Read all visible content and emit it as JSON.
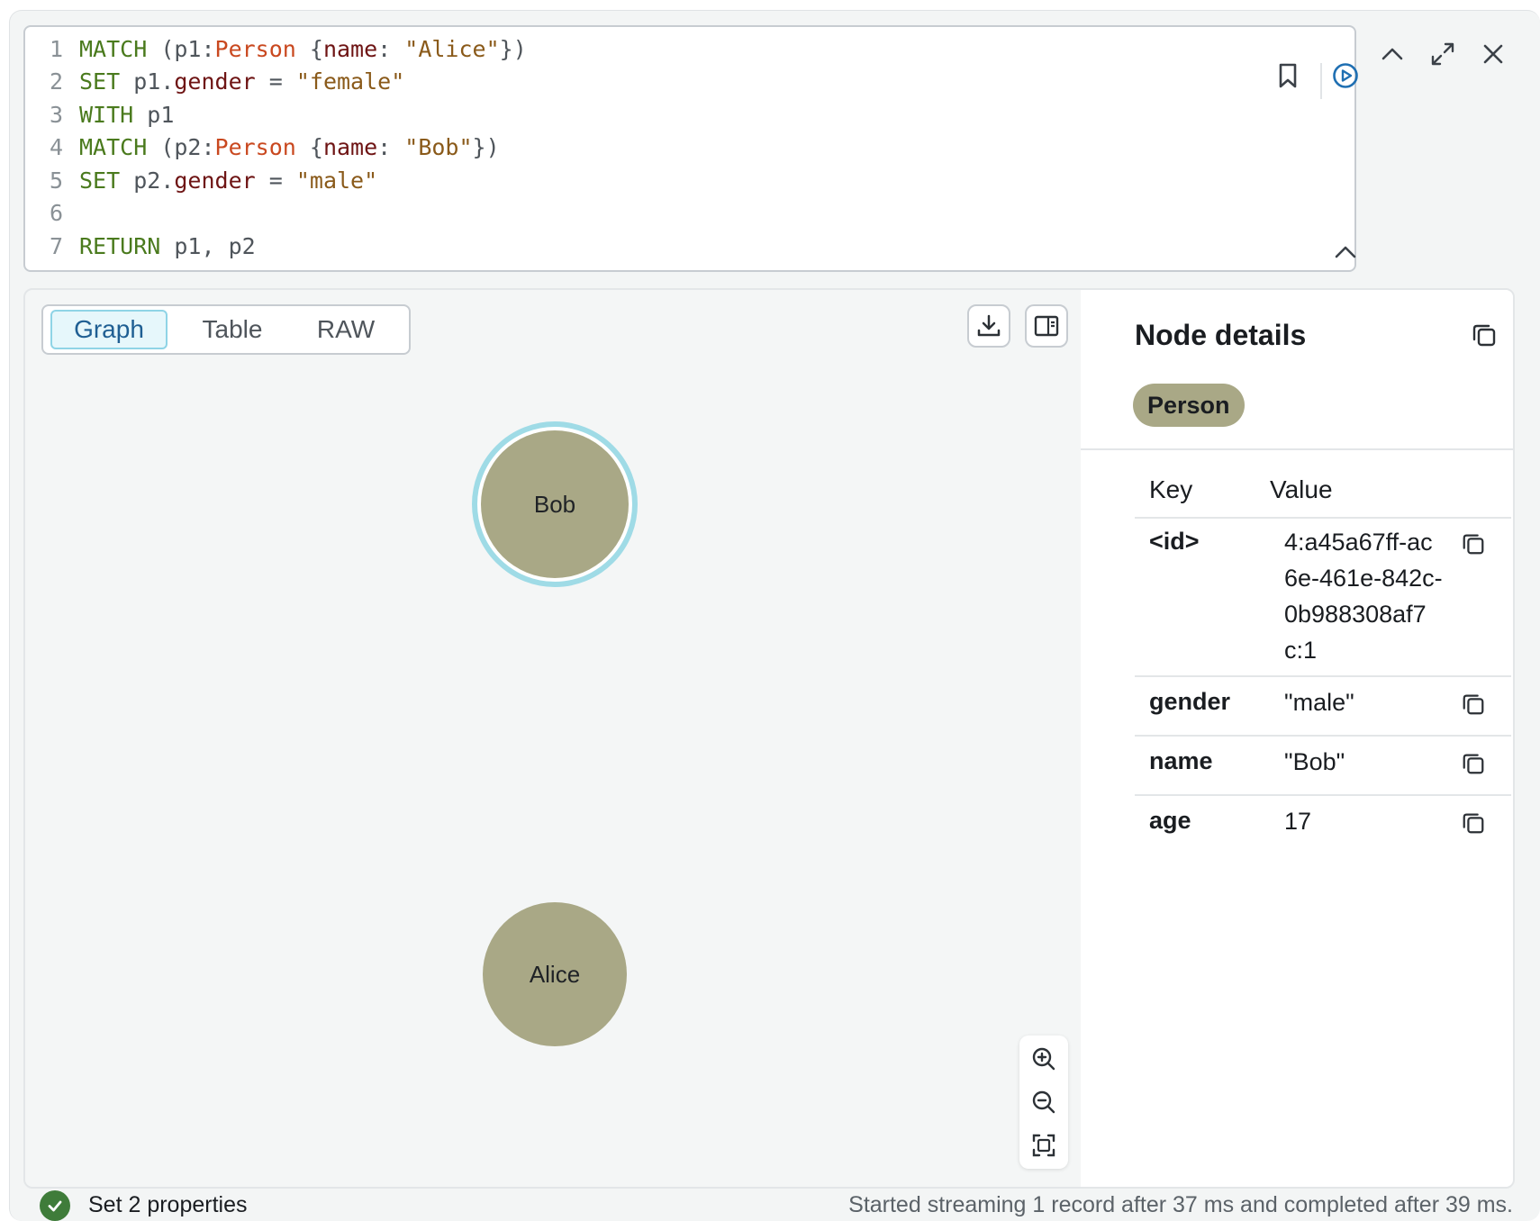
{
  "editor": {
    "lines": [
      {
        "num": "1",
        "tokens": [
          {
            "t": "MATCH",
            "c": "kw"
          },
          {
            "t": " (p1:",
            "c": "plain"
          },
          {
            "t": "Person",
            "c": "lbl"
          },
          {
            "t": " {",
            "c": "plain"
          },
          {
            "t": "name",
            "c": "prop"
          },
          {
            "t": ": ",
            "c": "plain"
          },
          {
            "t": "\"Alice\"",
            "c": "str"
          },
          {
            "t": "})",
            "c": "plain"
          }
        ]
      },
      {
        "num": "2",
        "tokens": [
          {
            "t": "SET",
            "c": "kw"
          },
          {
            "t": " p1.",
            "c": "plain"
          },
          {
            "t": "gender",
            "c": "prop"
          },
          {
            "t": " = ",
            "c": "plain"
          },
          {
            "t": "\"female\"",
            "c": "str"
          }
        ]
      },
      {
        "num": "3",
        "tokens": [
          {
            "t": "WITH",
            "c": "kw"
          },
          {
            "t": " p1",
            "c": "plain"
          }
        ]
      },
      {
        "num": "4",
        "tokens": [
          {
            "t": "MATCH",
            "c": "kw"
          },
          {
            "t": " (p2:",
            "c": "plain"
          },
          {
            "t": "Person",
            "c": "lbl"
          },
          {
            "t": " {",
            "c": "plain"
          },
          {
            "t": "name",
            "c": "prop"
          },
          {
            "t": ": ",
            "c": "plain"
          },
          {
            "t": "\"Bob\"",
            "c": "str"
          },
          {
            "t": "})",
            "c": "plain"
          }
        ]
      },
      {
        "num": "5",
        "tokens": [
          {
            "t": "SET",
            "c": "kw"
          },
          {
            "t": " p2.",
            "c": "plain"
          },
          {
            "t": "gender",
            "c": "prop"
          },
          {
            "t": " = ",
            "c": "plain"
          },
          {
            "t": "\"male\"",
            "c": "str"
          }
        ]
      },
      {
        "num": "6",
        "tokens": []
      },
      {
        "num": "7",
        "tokens": [
          {
            "t": "RETURN",
            "c": "kw"
          },
          {
            "t": " p1, p2",
            "c": "plain"
          }
        ]
      }
    ]
  },
  "icons": {
    "bookmark": "bookmark-icon",
    "run": "play-circle-icon",
    "collapse": "chevron-up-icon",
    "expand": "expand-icon",
    "close": "close-icon",
    "download": "download-icon",
    "panel": "side-panel-icon",
    "zoom_in": "zoom-in-icon",
    "zoom_out": "zoom-out-icon",
    "fit": "fit-to-screen-icon",
    "copy": "copy-icon",
    "check": "check-icon"
  },
  "tabs": [
    {
      "label": "Graph",
      "active": true
    },
    {
      "label": "Table",
      "active": false
    },
    {
      "label": "RAW",
      "active": false
    }
  ],
  "graph": {
    "nodes": [
      {
        "label": "Bob",
        "selected": true
      },
      {
        "label": "Alice",
        "selected": false
      }
    ],
    "node_color": "#a9a886",
    "selection_color": "#9fdbe6"
  },
  "details": {
    "title": "Node details",
    "node_label": "Person",
    "col_key": "Key",
    "col_value": "Value",
    "rows": [
      {
        "key": "<id>",
        "value_lines": [
          "4:a45a67ff-ac",
          "6e-461e-842c-",
          "0b988308af7",
          "c:1"
        ]
      },
      {
        "key": "gender",
        "value_lines": [
          "\"male\""
        ]
      },
      {
        "key": "name",
        "value_lines": [
          "\"Bob\""
        ]
      },
      {
        "key": "age",
        "value_lines": [
          "17"
        ]
      }
    ]
  },
  "status": {
    "summary": "Set 2 properties",
    "timing": "Started streaming 1 record after 37 ms and completed after 39 ms.",
    "success_color": "#3f7c3a"
  }
}
